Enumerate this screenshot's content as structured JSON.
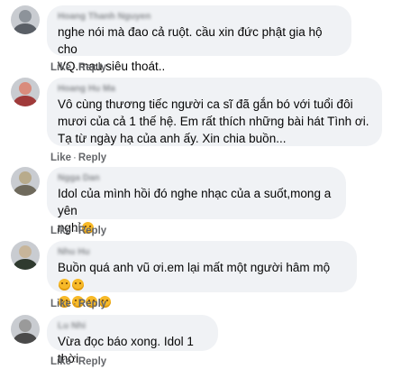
{
  "colors": {
    "bubble": "#f0f2f5",
    "action": "#65676b",
    "text": "#050505"
  },
  "comments": [
    {
      "name": "Hoang Thanh Nguyen",
      "text": "nghe nói mà đao cả ruột. cầu xin đức phật gia hộ cho\nVQ.mau siêu thoát..",
      "like": "Like",
      "sep": "·",
      "reply": "Reply",
      "avatar_colors": [
        "#5a5f66",
        "#8d939a"
      ]
    },
    {
      "name": "Hoang Hu Ma",
      "text": "Vô cùng thương tiếc người ca sĩ đã gắn bó với tuổi đôi\nmươi của cả 1 thế hệ. Em rất thích những bài hát Tình ơi.\nTạ từ ngày hạ của anh ấy. Xin chia buồn...",
      "like": "Like",
      "sep": "·",
      "reply": "Reply",
      "avatar_colors": [
        "#a03a3a",
        "#d98b7c"
      ]
    },
    {
      "name": "Ngga Dan",
      "text": "Idol của mình hồi đó nghe nhạc của a suốt,mong a yên\nnghỉ",
      "like": "Like",
      "sep": "·",
      "reply": "Reply",
      "avatar_colors": [
        "#6f6a5c",
        "#b8ab8c"
      ]
    },
    {
      "name": "Nhu Hu",
      "text": "Buồn quá anh vũ ơi.em lại mất một người hâm mộ",
      "like": "Like",
      "sep": "·",
      "reply": "Reply",
      "avatar_colors": [
        "#2f3a2f",
        "#c7b59a"
      ]
    },
    {
      "name": "Lu Nhi",
      "text": "Vừa đọc báo xong. Idol 1 thời",
      "like": "Like",
      "sep": "·",
      "reply": "Reply",
      "avatar_colors": [
        "#4a4a4a",
        "#9a9a9a"
      ]
    }
  ]
}
